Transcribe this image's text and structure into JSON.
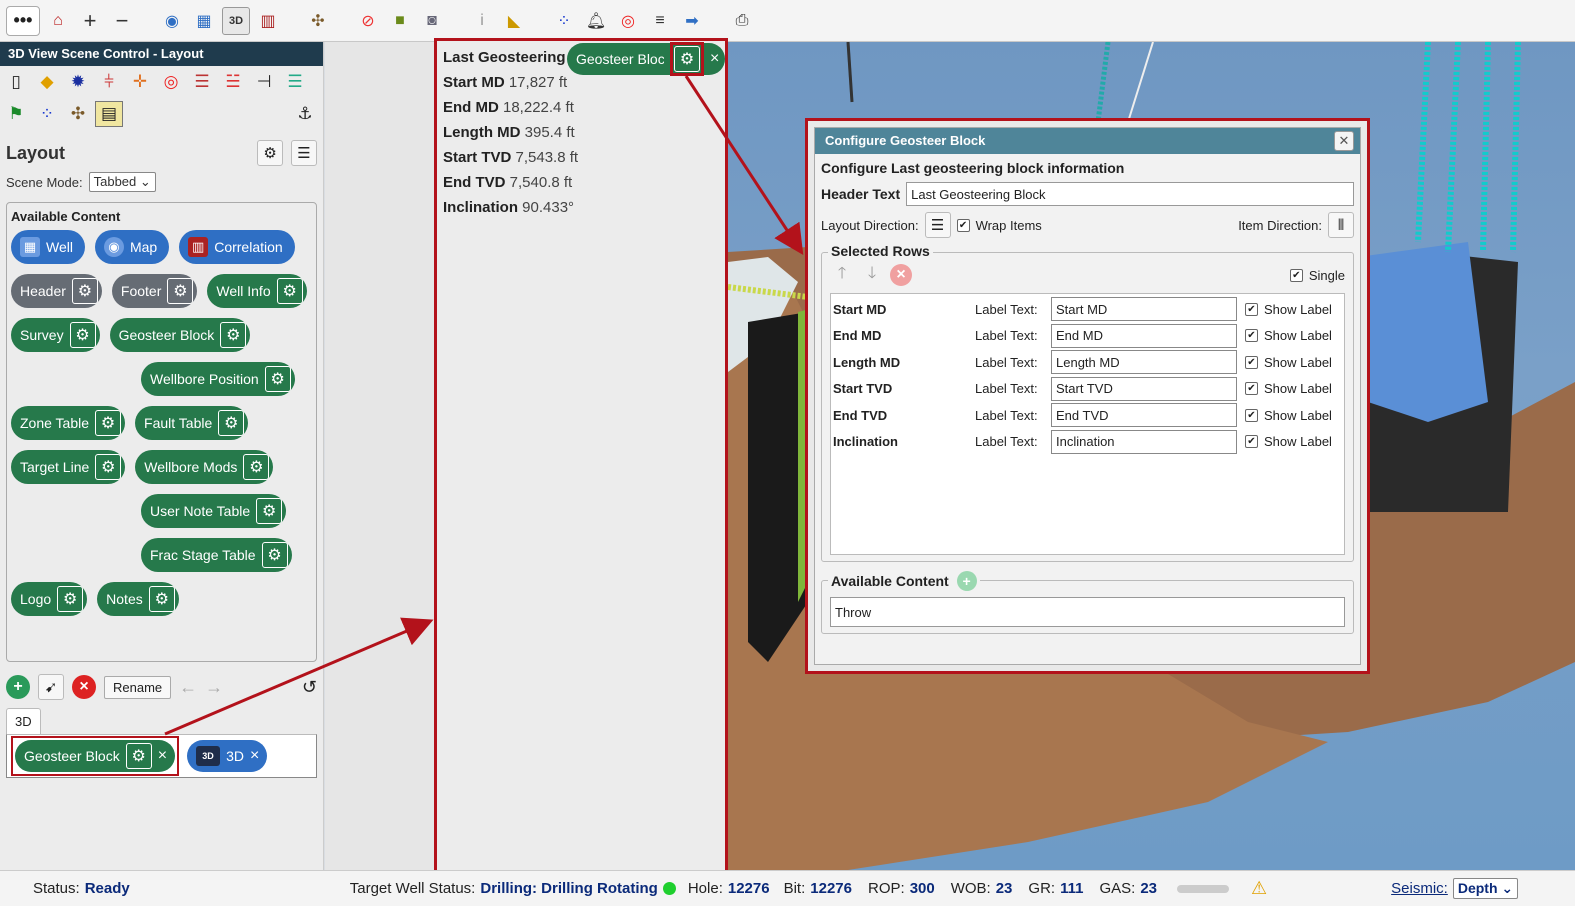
{
  "toolbar": {
    "items": [
      "more-icon",
      "home-icon",
      "zoom-in-icon",
      "zoom-out-icon",
      "compass-icon",
      "grid-icon",
      "3d-view-icon",
      "correlation-icon",
      "scene-icon",
      "target-icon",
      "cube-icon",
      "camera-icon",
      "info-icon",
      "ruler-icon",
      "wells-icon",
      "alarm-icon",
      "bullseye-icon",
      "lines-icon",
      "export-icon",
      "print-icon"
    ]
  },
  "left_panel": {
    "title": "3D View Scene Control - Layout",
    "layout_heading": "Layout",
    "scene_mode_label": "Scene Mode:",
    "scene_mode_value": "Tabbed",
    "available_heading": "Available Content",
    "view_chips": [
      {
        "label": "Well"
      },
      {
        "label": "Map"
      },
      {
        "label": "Correlation"
      }
    ],
    "chips": [
      {
        "label": "Header",
        "style": "gray"
      },
      {
        "label": "Footer",
        "style": "gray"
      },
      {
        "label": "Well Info",
        "style": "green"
      },
      {
        "label": "Survey",
        "style": "green"
      },
      {
        "label": "Geosteer Block",
        "style": "green"
      },
      {
        "label": "Wellbore Position",
        "style": "green"
      },
      {
        "label": "Zone Table",
        "style": "green"
      },
      {
        "label": "Fault Table",
        "style": "green"
      },
      {
        "label": "Target Line",
        "style": "green"
      },
      {
        "label": "Wellbore Mods",
        "style": "green"
      },
      {
        "label": "User Note Table",
        "style": "green"
      },
      {
        "label": "Frac Stage Table",
        "style": "green"
      },
      {
        "label": "Logo",
        "style": "green"
      },
      {
        "label": "Notes",
        "style": "green"
      }
    ],
    "rename_label": "Rename",
    "tab_label": "3D",
    "used": {
      "geosteer_label": "Geosteer Block",
      "view_label": "3D",
      "view_icon_text": "3D"
    }
  },
  "preview": {
    "title": "Last Geosteering",
    "pill_label": "Geosteer Block",
    "rows": [
      {
        "label": "Start MD",
        "value": "17,827 ft"
      },
      {
        "label": "End MD",
        "value": "18,222.4 ft"
      },
      {
        "label": "Length MD",
        "value": "395.4 ft"
      },
      {
        "label": "Start TVD",
        "value": "7,543.8 ft"
      },
      {
        "label": "End TVD",
        "value": "7,540.8 ft"
      },
      {
        "label": "Inclination",
        "value": "90.433°"
      }
    ]
  },
  "dialog": {
    "title": "Configure Geosteer Block",
    "subtitle": "Configure Last geosteering block information",
    "header_text_label": "Header Text",
    "header_text_value": "Last Geosteering Block",
    "layout_direction_label": "Layout Direction:",
    "wrap_items_label": "Wrap Items",
    "item_direction_label": "Item Direction:",
    "selected_rows_legend": "Selected Rows",
    "single_label": "Single",
    "label_text_caption": "Label Text:",
    "show_label_caption": "Show Label",
    "rows": [
      {
        "name": "Start MD",
        "label_text": "Start MD"
      },
      {
        "name": "End MD",
        "label_text": "End MD"
      },
      {
        "name": "Length MD",
        "label_text": "Length MD"
      },
      {
        "name": "Start TVD",
        "label_text": "Start TVD"
      },
      {
        "name": "End TVD",
        "label_text": "End TVD"
      },
      {
        "name": "Inclination",
        "label_text": "Inclination"
      }
    ],
    "available_content_legend": "Available Content",
    "available_items": [
      "Throw"
    ]
  },
  "status_bar": {
    "status_label": "Status:",
    "status_value": "Ready",
    "target_label": "Target Well Status:",
    "target_value": "Drilling: Drilling Rotating",
    "hole_label": "Hole:",
    "hole_value": "12276",
    "bit_label": "Bit:",
    "bit_value": "12276",
    "rop_label": "ROP:",
    "rop_value": "300",
    "wob_label": "WOB:",
    "wob_value": "23",
    "gr_label": "GR:",
    "gr_value": "111",
    "gas_label": "GAS:",
    "gas_value": "23",
    "seismic_label": "Seismic:",
    "seismic_value": "Depth"
  },
  "colors": {
    "accent_green": "#26794b",
    "accent_blue": "#2f6fc4",
    "highlight_red": "#b3121b",
    "dialog_title": "#4f8599"
  }
}
